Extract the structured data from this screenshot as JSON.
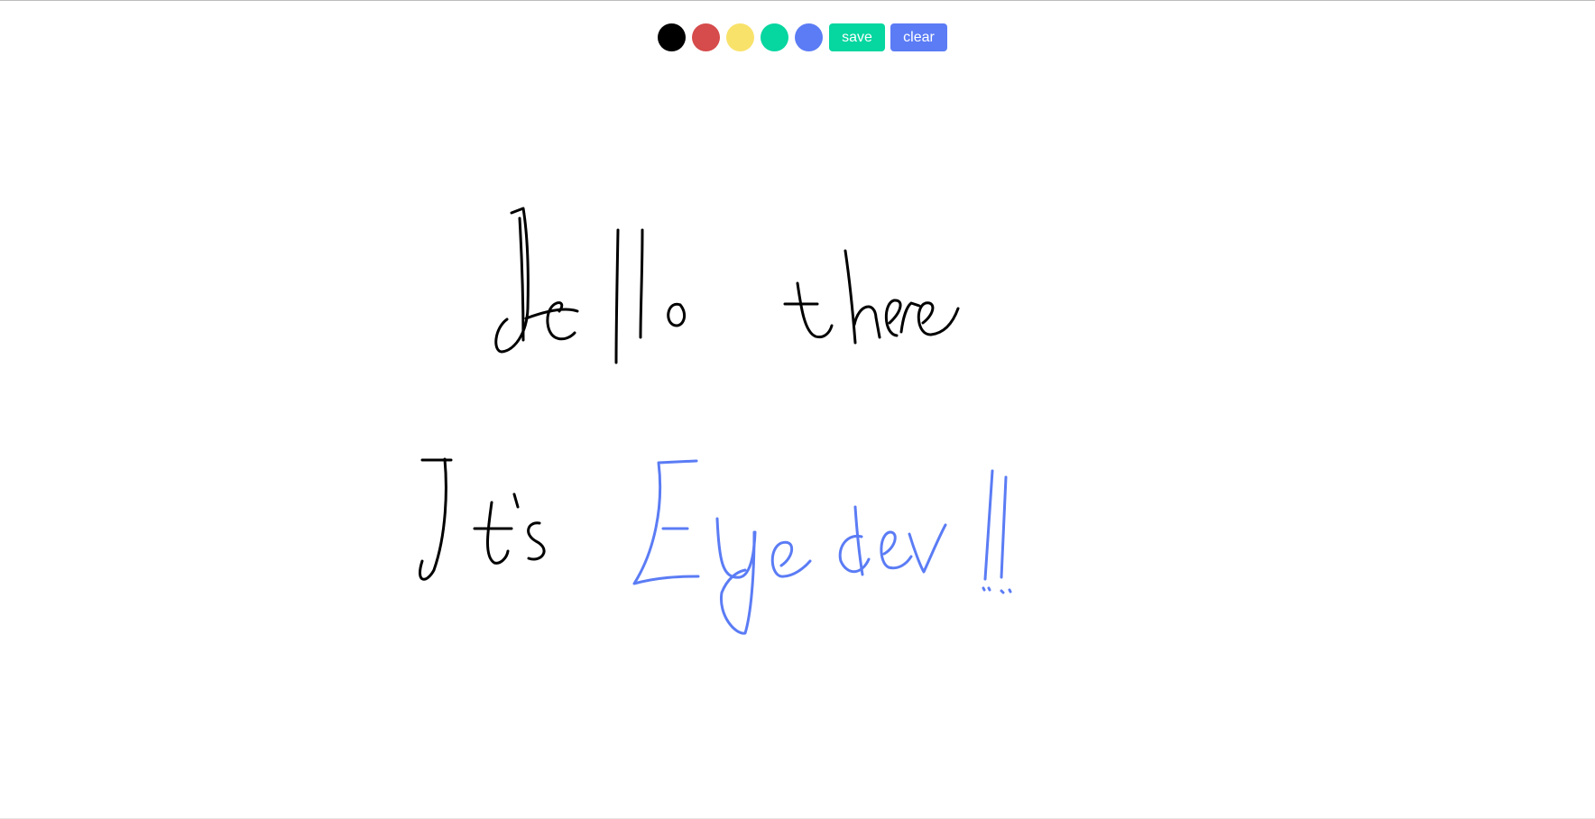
{
  "toolbar": {
    "colors": [
      {
        "name": "black",
        "hex": "#000000"
      },
      {
        "name": "red",
        "hex": "#d64b4b"
      },
      {
        "name": "yellow",
        "hex": "#f9e26a"
      },
      {
        "name": "green",
        "hex": "#06d6a0"
      },
      {
        "name": "blue",
        "hex": "#5b7cf5"
      }
    ],
    "save_label": "save",
    "save_color": "#06d6a0",
    "clear_label": "clear",
    "clear_color": "#5b7cf5"
  },
  "drawing": {
    "ink_colors": {
      "black": "#000000",
      "blue": "#5b7cf5"
    }
  }
}
